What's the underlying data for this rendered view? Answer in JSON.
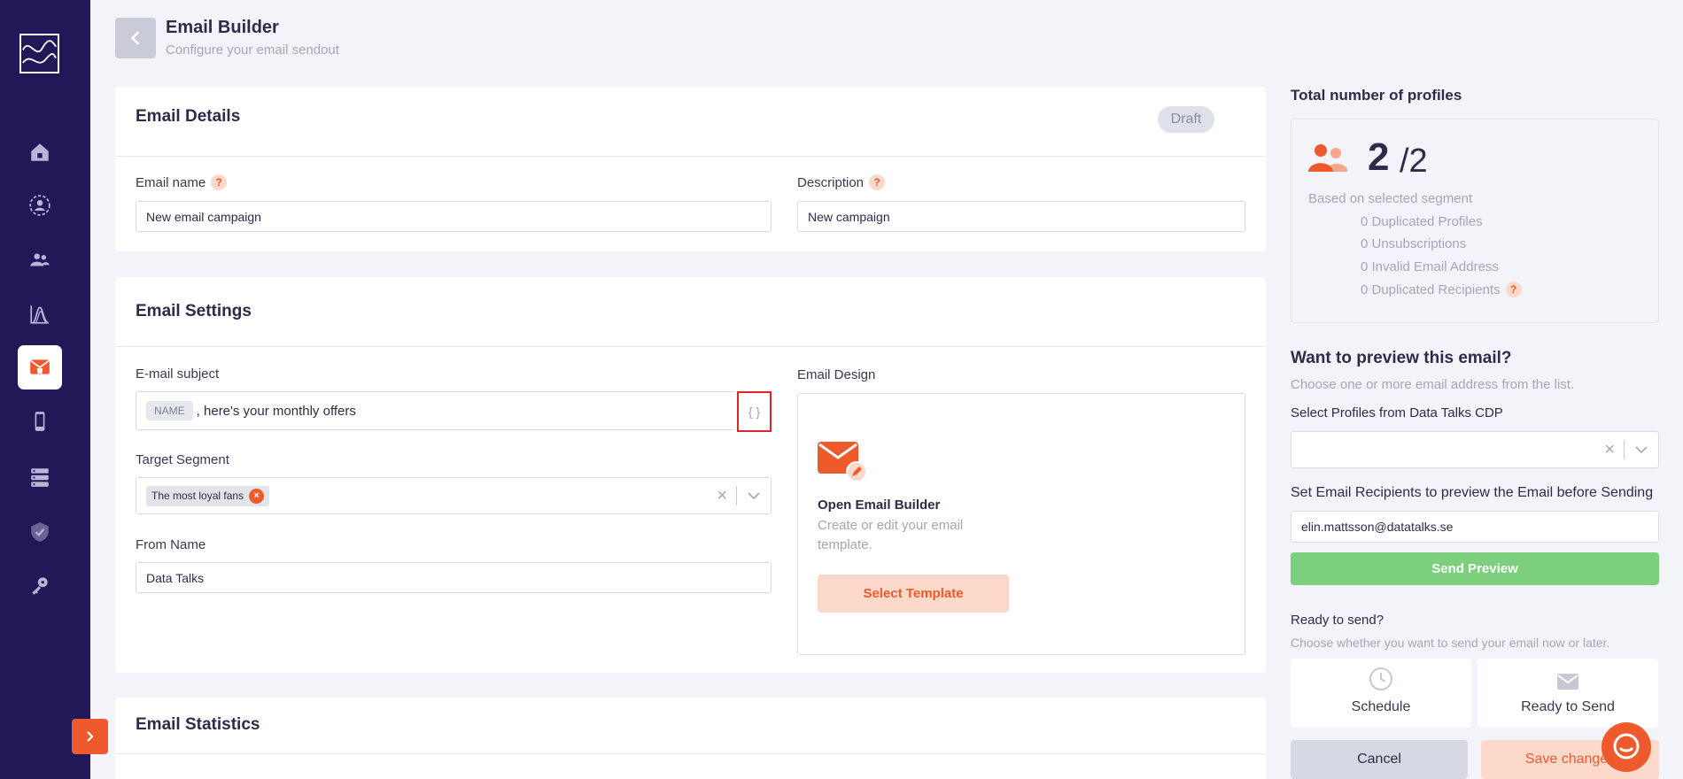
{
  "header": {
    "title": "Email Builder",
    "subtitle": "Configure your email sendout"
  },
  "sidebar": {
    "items": [
      {
        "name": "home-icon"
      },
      {
        "name": "profile-icon"
      },
      {
        "name": "segments-icon"
      },
      {
        "name": "analytics-icon"
      },
      {
        "name": "email-icon",
        "active": true
      },
      {
        "name": "mobile-icon"
      },
      {
        "name": "database-icon"
      },
      {
        "name": "shield-icon"
      },
      {
        "name": "key-icon"
      }
    ]
  },
  "email_details": {
    "title": "Email Details",
    "status": "Draft",
    "name_label": "Email name",
    "name_value": "New email campaign",
    "description_label": "Description",
    "description_value": "New campaign",
    "help": "?"
  },
  "email_settings": {
    "title": "Email Settings",
    "subject_label": "E-mail subject",
    "subject_chip": "NAME",
    "subject_text": ", here's your monthly offers",
    "variables_button": "{ }",
    "segment_label": "Target Segment",
    "segment_chip": "The most loyal fans",
    "from_label": "From Name",
    "from_value": "Data Talks",
    "design_label": "Email Design",
    "design_title": "Open Email Builder",
    "design_desc": "Create or edit your email template.",
    "template_button": "Select Template"
  },
  "email_statistics": {
    "title": "Email Statistics"
  },
  "profiles": {
    "title": "Total number of profiles",
    "count": "2",
    "total": "/2",
    "based_on": "Based on selected segment",
    "stats": [
      "0 Duplicated Profiles",
      "0 Unsubscriptions",
      "0 Invalid Email Address",
      "0 Duplicated Recipients"
    ]
  },
  "preview": {
    "title": "Want to preview this email?",
    "subtitle": "Choose one or more email address from the list.",
    "select_label": "Select Profiles from Data Talks CDP",
    "recipients_label": "Set Email Recipients to preview the Email before Sending",
    "recipients_value": "elin.mattsson@datatalks.se",
    "send_button": "Send Preview"
  },
  "send": {
    "title": "Ready to send?",
    "subtitle": "Choose whether you want to send your email now or later.",
    "schedule_label": "Schedule",
    "ready_label": "Ready to Send",
    "cancel_button": "Cancel",
    "save_button": "Save changes"
  },
  "colors": {
    "sidebar": "#221757",
    "accent": "#ef5a2c",
    "success": "#7ccf7d"
  }
}
